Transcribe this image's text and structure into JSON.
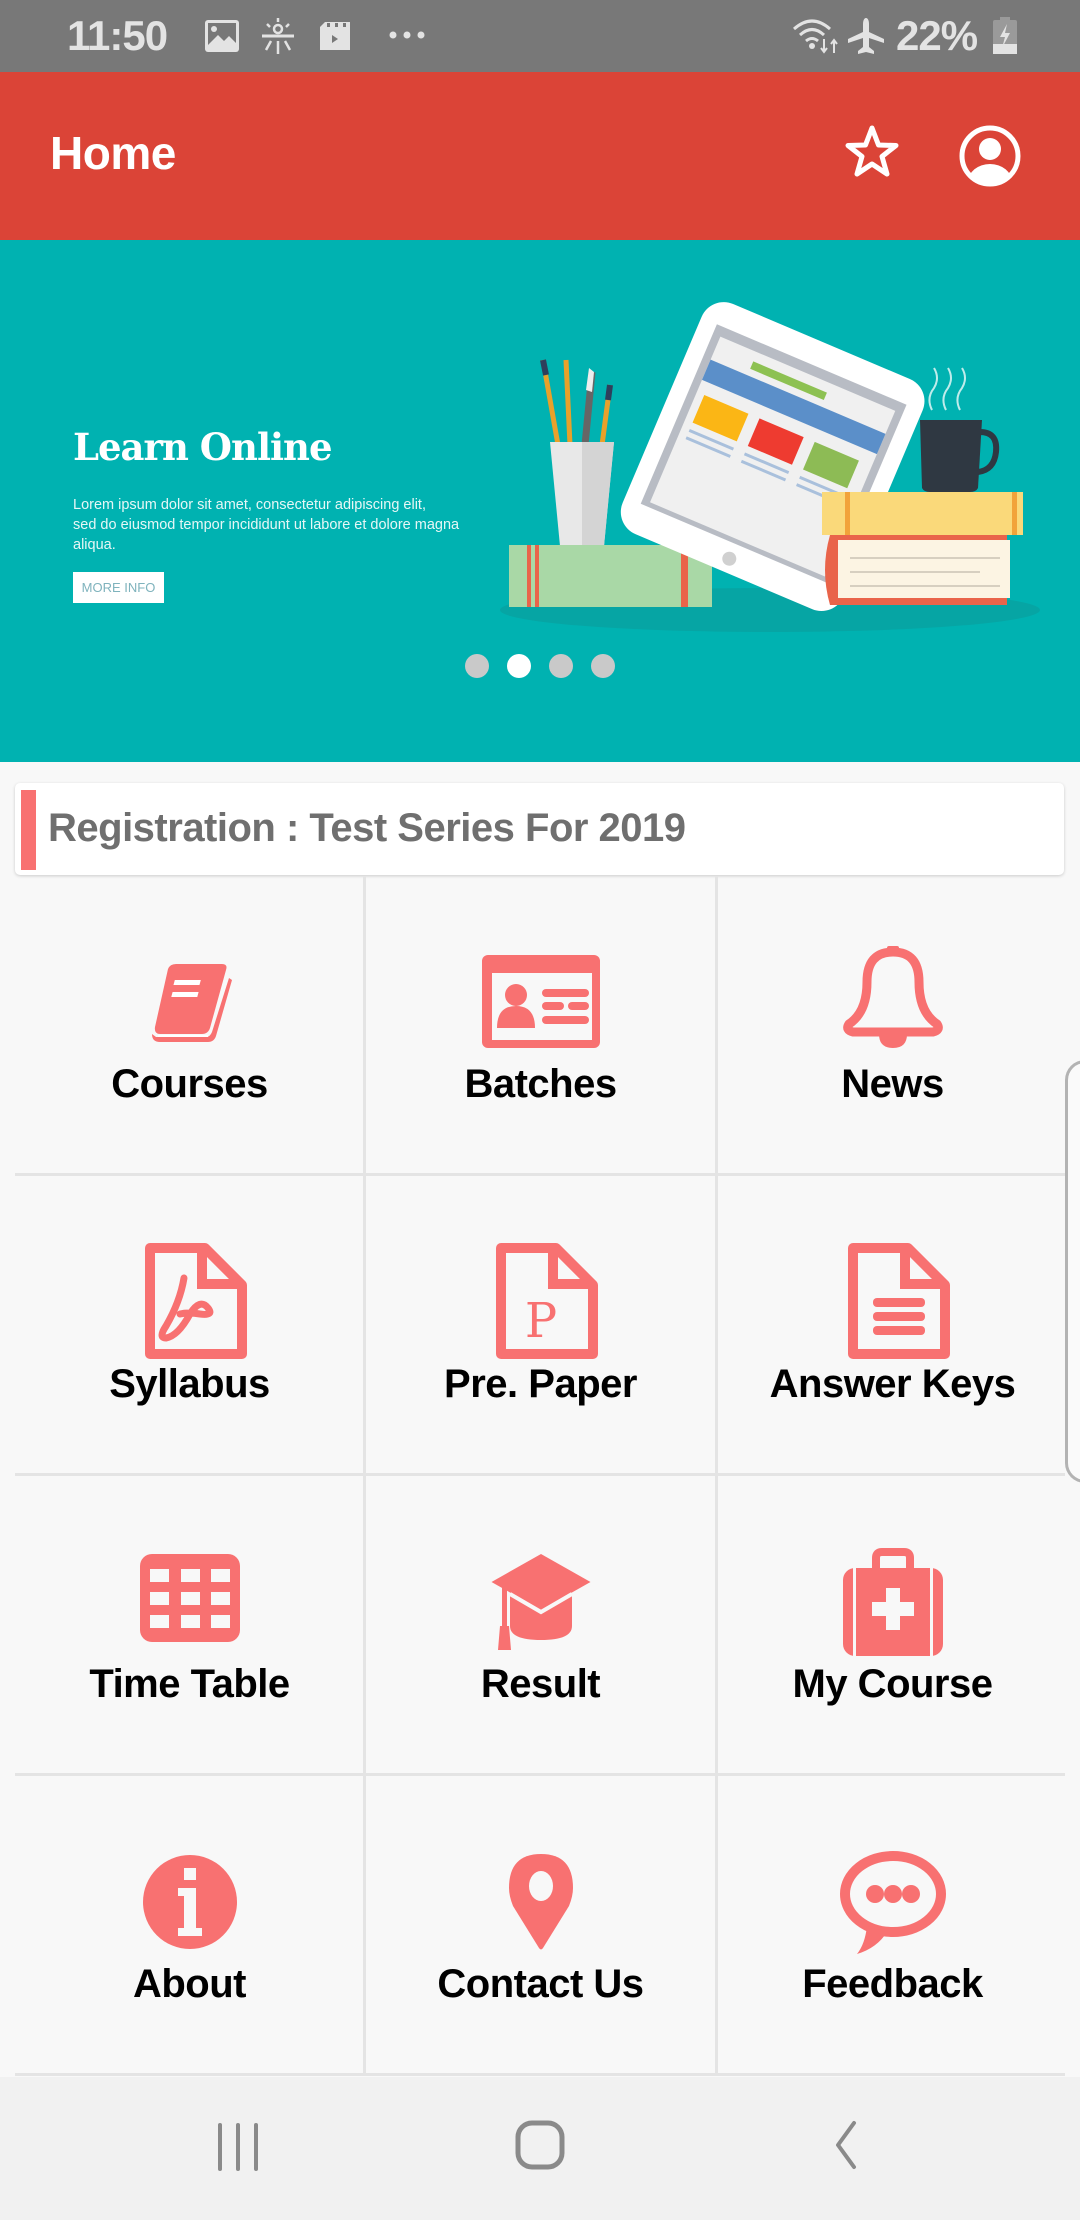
{
  "status_bar": {
    "time": "11:50",
    "left_icons": [
      "gallery-icon",
      "brightness-icon",
      "video-clip-icon",
      "more-dots-icon"
    ],
    "right_icons": [
      "wifi-data-icon",
      "airplane-mode-icon",
      "battery-charging-icon"
    ],
    "battery_percent": "22%"
  },
  "app_bar": {
    "title": "Home",
    "actions": [
      {
        "name": "favorite",
        "icon": "star-outline-icon"
      },
      {
        "name": "profile",
        "icon": "account-circle-icon"
      }
    ]
  },
  "banner": {
    "title": "Learn Online",
    "text_line1": "Lorem ipsum dolor sit amet, consectetur adipiscing elit,",
    "text_line2": "sed do eiusmod tempor incididunt ut labore et dolore magna aliqua.",
    "button_label": "MORE INFO",
    "slides_count": 4,
    "active_slide": 2
  },
  "announcement": {
    "text": "Registration : Test Series For 2019"
  },
  "menu": {
    "accent_color": "#f87171",
    "items": [
      {
        "label": "Courses",
        "icon": "book-icon"
      },
      {
        "label": "Batches",
        "icon": "id-card-icon"
      },
      {
        "label": "News",
        "icon": "bell-icon"
      },
      {
        "label": "Syllabus",
        "icon": "pdf-file-icon"
      },
      {
        "label": "Pre. Paper",
        "icon": "paper-file-icon"
      },
      {
        "label": "Answer Keys",
        "icon": "document-icon"
      },
      {
        "label": "Time Table",
        "icon": "calendar-grid-icon"
      },
      {
        "label": "Result",
        "icon": "graduation-cap-icon"
      },
      {
        "label": "My Course",
        "icon": "medical-kit-icon"
      },
      {
        "label": "About",
        "icon": "info-icon"
      },
      {
        "label": "Contact Us",
        "icon": "map-pin-icon"
      },
      {
        "label": "Feedback",
        "icon": "chat-bubble-icon"
      }
    ]
  },
  "nav_bar": {
    "buttons": [
      "recent-apps",
      "home",
      "back"
    ]
  },
  "colors": {
    "status_bar": "#787878",
    "app_bar": "#db4437",
    "banner": "#00b2b1",
    "accent": "#f87171"
  }
}
